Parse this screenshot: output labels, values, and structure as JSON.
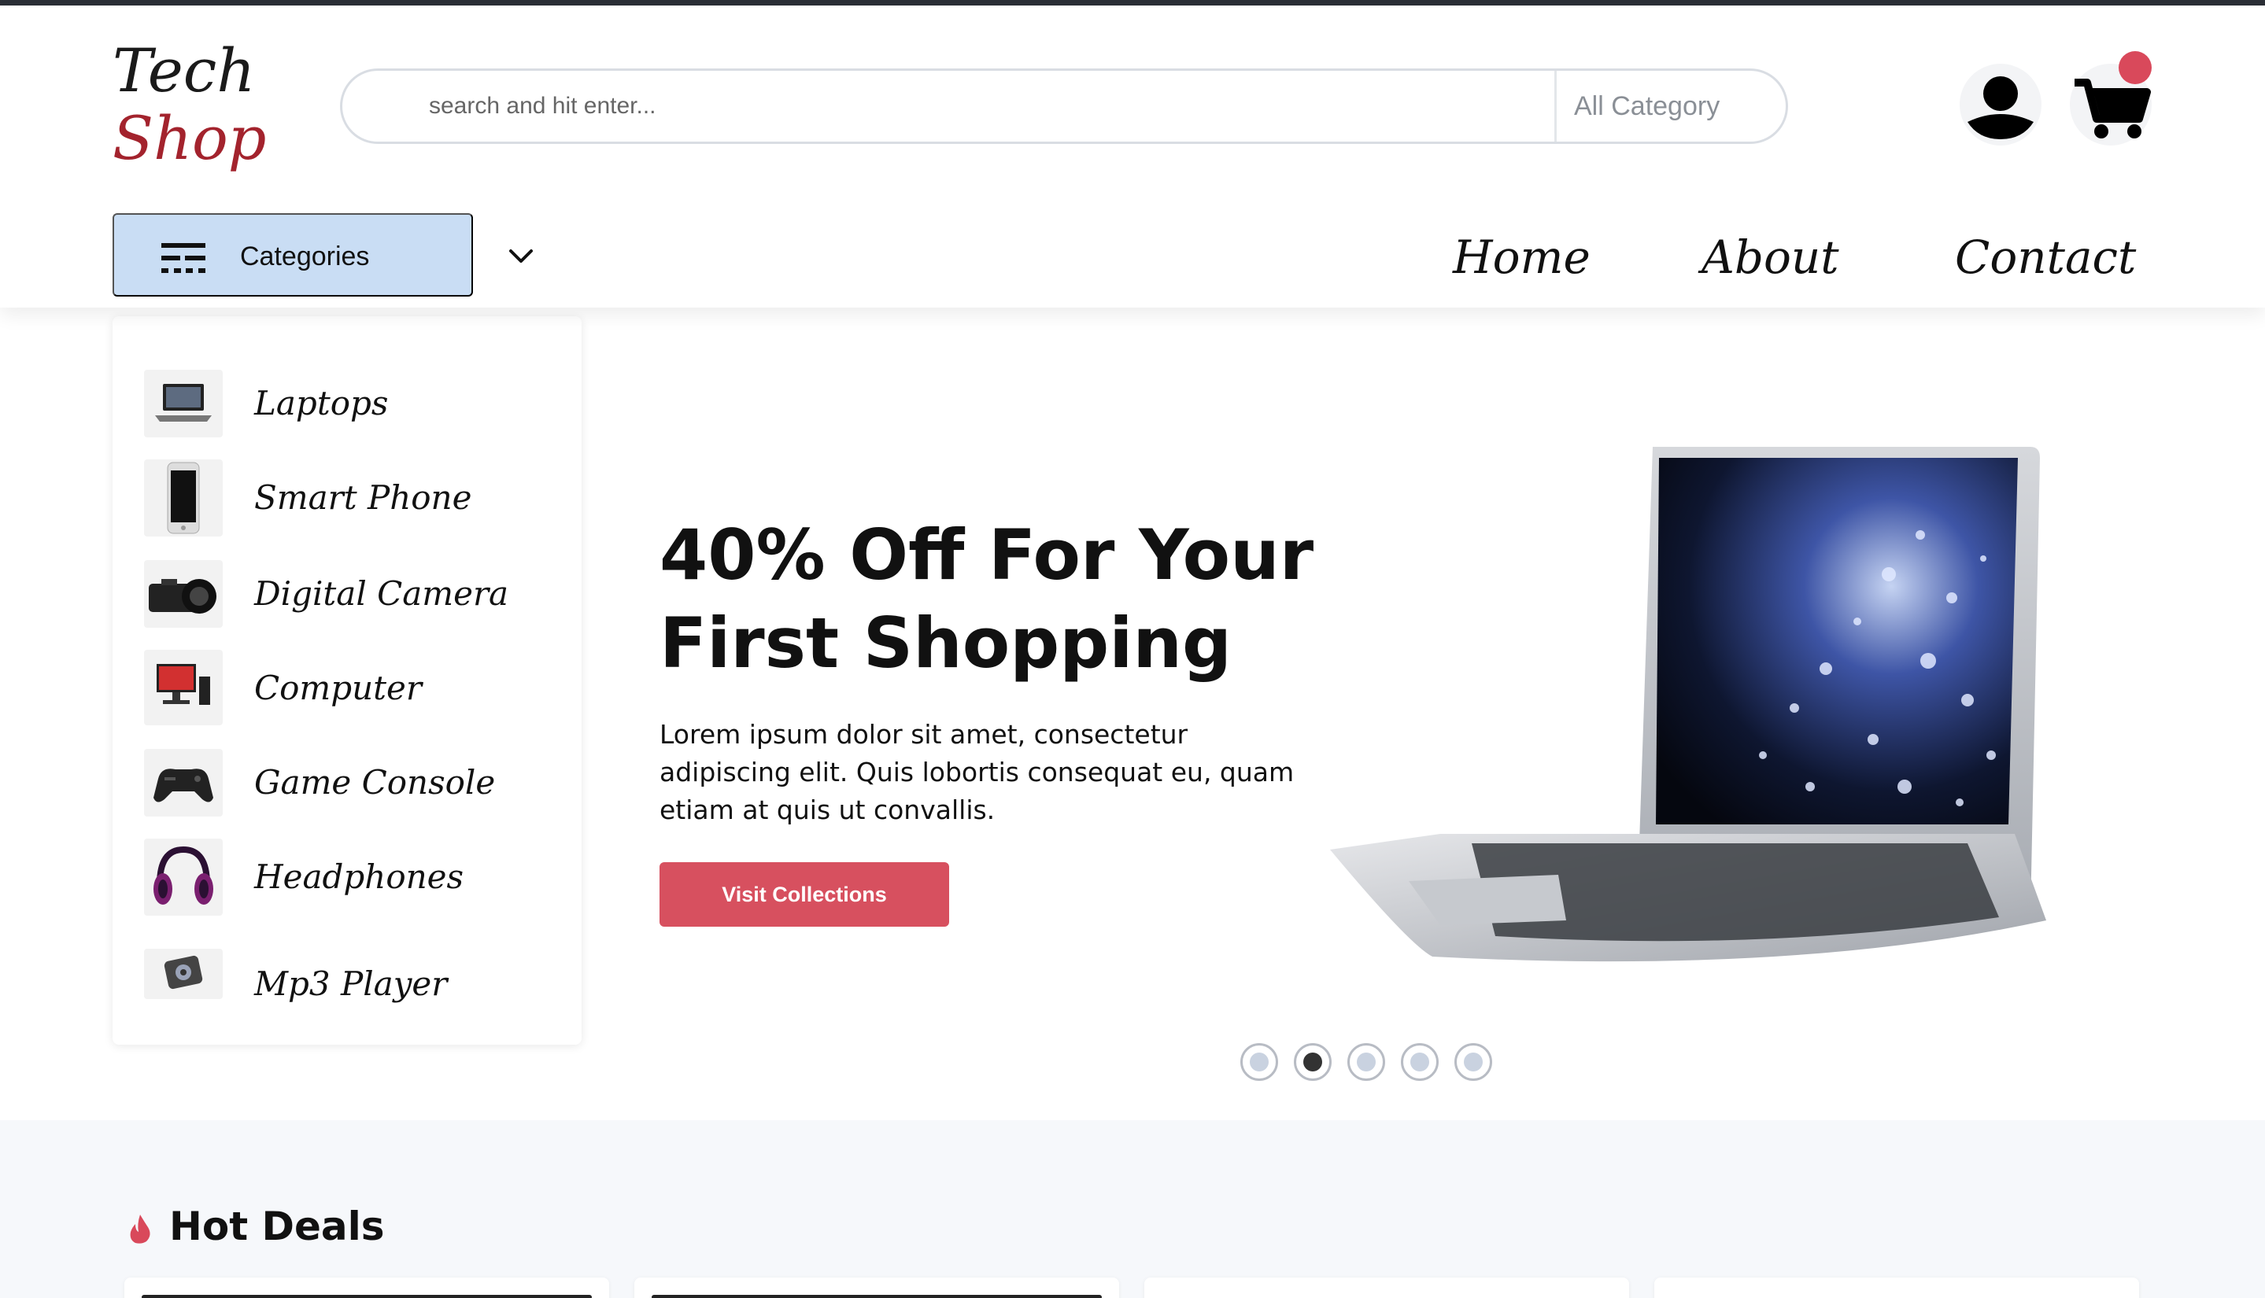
{
  "brand": {
    "line1": "Tech",
    "line2": "Shop"
  },
  "search": {
    "placeholder": "search and hit enter...",
    "category": "All Category"
  },
  "header": {
    "cart_badge_color": "#d9495b"
  },
  "categories_button": {
    "label": "Categories"
  },
  "nav": [
    {
      "label": "Home"
    },
    {
      "label": "About"
    },
    {
      "label": "Contact"
    }
  ],
  "sidebar": {
    "items": [
      {
        "label": "Laptops",
        "icon": "laptop-icon"
      },
      {
        "label": "Smart Phone",
        "icon": "smartphone-icon"
      },
      {
        "label": "Digital Camera",
        "icon": "camera-icon"
      },
      {
        "label": "Computer",
        "icon": "computer-icon"
      },
      {
        "label": "Game Console",
        "icon": "gamepad-icon"
      },
      {
        "label": "Headphones",
        "icon": "headphones-icon"
      },
      {
        "label": "Mp3 Player",
        "icon": "mp3-player-icon"
      }
    ]
  },
  "hero": {
    "title_line1": "40% Off For Your",
    "title_line2": "First Shopping",
    "text": "Lorem ipsum dolor sit amet, consectetur adipiscing elit. Quis lobortis consequat eu, quam etiam at quis ut convallis.",
    "cta": "Visit Collections",
    "cta_color": "#d7505f",
    "slide_count": 5,
    "active_slide": 2
  },
  "deals": {
    "title": "Hot Deals",
    "accent_color": "#d9495b"
  }
}
